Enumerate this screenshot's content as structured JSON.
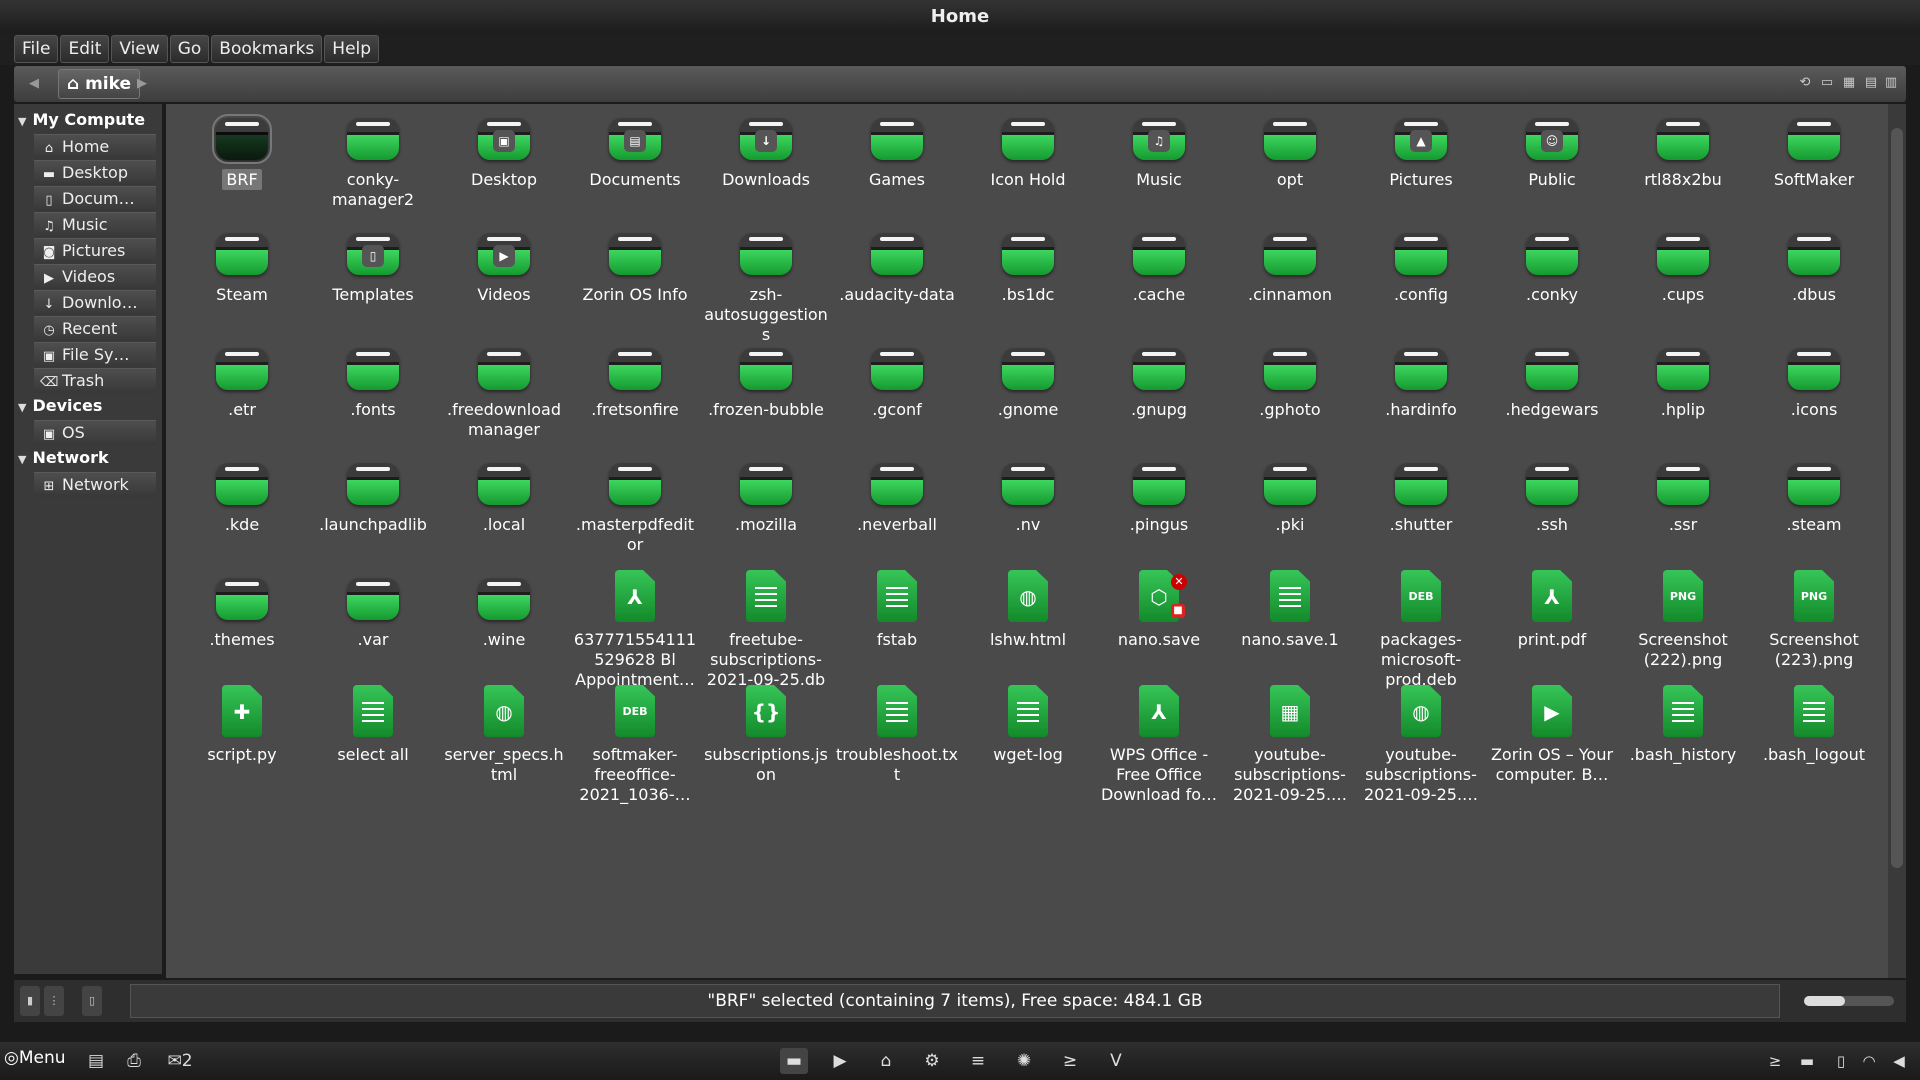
{
  "window": {
    "title": "Home"
  },
  "menubar": [
    "File",
    "Edit",
    "View",
    "Go",
    "Bookmarks",
    "Help"
  ],
  "location": {
    "crumb": "mike"
  },
  "sidebar": {
    "sections": [
      {
        "title": "My Compute",
        "items": [
          {
            "label": "Home",
            "icon": "home-icon"
          },
          {
            "label": "Desktop",
            "icon": "folder-icon"
          },
          {
            "label": "Docum…",
            "icon": "document-icon"
          },
          {
            "label": "Music",
            "icon": "music-icon"
          },
          {
            "label": "Pictures",
            "icon": "camera-icon"
          },
          {
            "label": "Videos",
            "icon": "video-icon"
          },
          {
            "label": "Downlo…",
            "icon": "download-icon"
          },
          {
            "label": "Recent",
            "icon": "clock-icon"
          },
          {
            "label": "File Sy…",
            "icon": "drive-icon"
          },
          {
            "label": "Trash",
            "icon": "trash-icon"
          }
        ]
      },
      {
        "title": "Devices",
        "items": [
          {
            "label": "OS",
            "icon": "disk-icon"
          }
        ]
      },
      {
        "title": "Network",
        "items": [
          {
            "label": "Network",
            "icon": "network-icon"
          }
        ]
      }
    ]
  },
  "files": [
    {
      "name": "BRF",
      "kind": "folder",
      "selected": true,
      "dark": true
    },
    {
      "name": "conky-manager2",
      "kind": "folder"
    },
    {
      "name": "Desktop",
      "kind": "folder",
      "badge": "▣"
    },
    {
      "name": "Documents",
      "kind": "folder",
      "badge": "▤"
    },
    {
      "name": "Downloads",
      "kind": "folder",
      "badge": "↓"
    },
    {
      "name": "Games",
      "kind": "folder"
    },
    {
      "name": "Icon Hold",
      "kind": "folder"
    },
    {
      "name": "Music",
      "kind": "folder",
      "badge": "♫"
    },
    {
      "name": "opt",
      "kind": "folder"
    },
    {
      "name": "Pictures",
      "kind": "folder",
      "badge": "▲"
    },
    {
      "name": "Public",
      "kind": "folder",
      "badge": "☺"
    },
    {
      "name": "rtl88x2bu",
      "kind": "folder"
    },
    {
      "name": "SoftMaker",
      "kind": "folder"
    },
    {
      "name": "Steam",
      "kind": "folder"
    },
    {
      "name": "Templates",
      "kind": "folder",
      "badge": "▯"
    },
    {
      "name": "Videos",
      "kind": "folder",
      "badge": "▶"
    },
    {
      "name": "Zorin OS Info",
      "kind": "folder"
    },
    {
      "name": "zsh-autosuggestions",
      "kind": "folder"
    },
    {
      "name": ".audacity-data",
      "kind": "folder"
    },
    {
      "name": ".bs1dc",
      "kind": "folder"
    },
    {
      "name": ".cache",
      "kind": "folder"
    },
    {
      "name": ".cinnamon",
      "kind": "folder"
    },
    {
      "name": ".config",
      "kind": "folder"
    },
    {
      "name": ".conky",
      "kind": "folder"
    },
    {
      "name": ".cups",
      "kind": "folder"
    },
    {
      "name": ".dbus",
      "kind": "folder"
    },
    {
      "name": ".etr",
      "kind": "folder"
    },
    {
      "name": ".fonts",
      "kind": "folder"
    },
    {
      "name": ".freedownloadmanager",
      "kind": "folder"
    },
    {
      "name": ".fretsonfire",
      "kind": "folder"
    },
    {
      "name": ".frozen-bubble",
      "kind": "folder"
    },
    {
      "name": ".gconf",
      "kind": "folder"
    },
    {
      "name": ".gnome",
      "kind": "folder"
    },
    {
      "name": ".gnupg",
      "kind": "folder"
    },
    {
      "name": ".gphoto",
      "kind": "folder"
    },
    {
      "name": ".hardinfo",
      "kind": "folder"
    },
    {
      "name": ".hedgewars",
      "kind": "folder"
    },
    {
      "name": ".hplip",
      "kind": "folder"
    },
    {
      "name": ".icons",
      "kind": "folder"
    },
    {
      "name": ".kde",
      "kind": "folder"
    },
    {
      "name": ".launchpadlib",
      "kind": "folder"
    },
    {
      "name": ".local",
      "kind": "folder"
    },
    {
      "name": ".masterpdfeditor",
      "kind": "folder"
    },
    {
      "name": ".mozilla",
      "kind": "folder"
    },
    {
      "name": ".neverball",
      "kind": "folder"
    },
    {
      "name": ".nv",
      "kind": "folder"
    },
    {
      "name": ".pingus",
      "kind": "folder"
    },
    {
      "name": ".pki",
      "kind": "folder"
    },
    {
      "name": ".shutter",
      "kind": "folder"
    },
    {
      "name": ".ssh",
      "kind": "folder"
    },
    {
      "name": ".ssr",
      "kind": "folder"
    },
    {
      "name": ".steam",
      "kind": "folder"
    },
    {
      "name": ".themes",
      "kind": "folder"
    },
    {
      "name": ".var",
      "kind": "folder"
    },
    {
      "name": ".wine",
      "kind": "folder"
    },
    {
      "name": "637771554111529628 Bl Appointment…",
      "kind": "file",
      "glyph": "⅄"
    },
    {
      "name": "freetube-subscriptions-2021-09-25.db",
      "kind": "file",
      "glyph": "lines"
    },
    {
      "name": "fstab",
      "kind": "file",
      "glyph": "lines"
    },
    {
      "name": "lshw.html",
      "kind": "file",
      "glyph": "◍"
    },
    {
      "name": "nano.save",
      "kind": "file",
      "glyph": "⬡",
      "lock": true,
      "x": true
    },
    {
      "name": "nano.save.1",
      "kind": "file",
      "glyph": "lines"
    },
    {
      "name": "packages-microsoft-prod.deb",
      "kind": "file",
      "glyph": "DEB"
    },
    {
      "name": "print.pdf",
      "kind": "file",
      "glyph": "⅄"
    },
    {
      "name": "Screenshot (222).png",
      "kind": "file",
      "glyph": "PNG"
    },
    {
      "name": "Screenshot (223).png",
      "kind": "file",
      "glyph": "PNG"
    },
    {
      "name": "script.py",
      "kind": "file",
      "glyph": "✚"
    },
    {
      "name": "select all",
      "kind": "file",
      "glyph": "lines"
    },
    {
      "name": "server_specs.html",
      "kind": "file",
      "glyph": "◍"
    },
    {
      "name": "softmaker-freeoffice-2021_1036-…",
      "kind": "file",
      "glyph": "DEB"
    },
    {
      "name": "subscriptions.json",
      "kind": "file",
      "glyph": "{}"
    },
    {
      "name": "troubleshoot.txt",
      "kind": "file",
      "glyph": "lines"
    },
    {
      "name": "wget-log",
      "kind": "file",
      "glyph": "lines"
    },
    {
      "name": "WPS Office - Free Office Download fo…",
      "kind": "file",
      "glyph": "⅄"
    },
    {
      "name": "youtube-subscriptions-2021-09-25.…",
      "kind": "file",
      "glyph": "▦"
    },
    {
      "name": "youtube-subscriptions-2021-09-25.…",
      "kind": "file",
      "glyph": "◍"
    },
    {
      "name": "Zorin OS – Your computer. B…",
      "kind": "file",
      "glyph": "▶"
    },
    {
      "name": ".bash_history",
      "kind": "file",
      "glyph": "lines"
    },
    {
      "name": ".bash_logout",
      "kind": "file",
      "glyph": "lines"
    }
  ],
  "status": {
    "text": "\"BRF\" selected (containing 7 items), Free space: 484.1 GB",
    "zoom_level": 0.45
  },
  "taskbar": {
    "menu_label": "Menu",
    "workspace_count": "2"
  },
  "colors": {
    "accent": "#2fbf4f",
    "folder_dark": "#0f2a16",
    "background": "#4a4a4a"
  }
}
